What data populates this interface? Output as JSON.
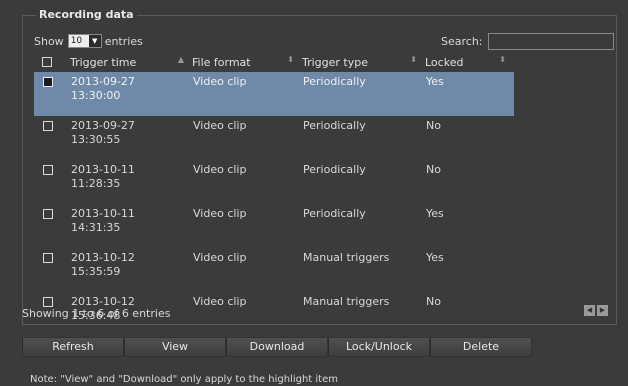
{
  "section_title": "Recording data",
  "length_control": {
    "prefix": "Show",
    "selected": "10",
    "suffix": "entries"
  },
  "search": {
    "label": "Search:",
    "value": ""
  },
  "columns": [
    "Trigger time",
    "File format",
    "Trigger type",
    "Locked"
  ],
  "rows": [
    {
      "date": "2013-09-27",
      "time": "13:30:00",
      "format": "Video clip",
      "trigger": "Periodically",
      "locked": "Yes",
      "selected": true
    },
    {
      "date": "2013-09-27",
      "time": "13:30:55",
      "format": "Video clip",
      "trigger": "Periodically",
      "locked": "No",
      "selected": false
    },
    {
      "date": "2013-10-11",
      "time": "11:28:35",
      "format": "Video clip",
      "trigger": "Periodically",
      "locked": "No",
      "selected": false
    },
    {
      "date": "2013-10-11",
      "time": "14:31:35",
      "format": "Video clip",
      "trigger": "Periodically",
      "locked": "Yes",
      "selected": false
    },
    {
      "date": "2013-10-12",
      "time": "15:35:59",
      "format": "Video clip",
      "trigger": "Manual triggers",
      "locked": "Yes",
      "selected": false
    },
    {
      "date": "2013-10-12",
      "time": "15:36:48",
      "format": "Video clip",
      "trigger": "Manual triggers",
      "locked": "No",
      "selected": false
    }
  ],
  "info": "Showing 1 to 6 of 6 entries",
  "buttons": {
    "refresh": "Refresh",
    "view": "View",
    "download": "Download",
    "lock": "Lock/Unlock",
    "delete": "Delete"
  },
  "note": "Note: \"View\" and \"Download\" only apply to the highlight item"
}
